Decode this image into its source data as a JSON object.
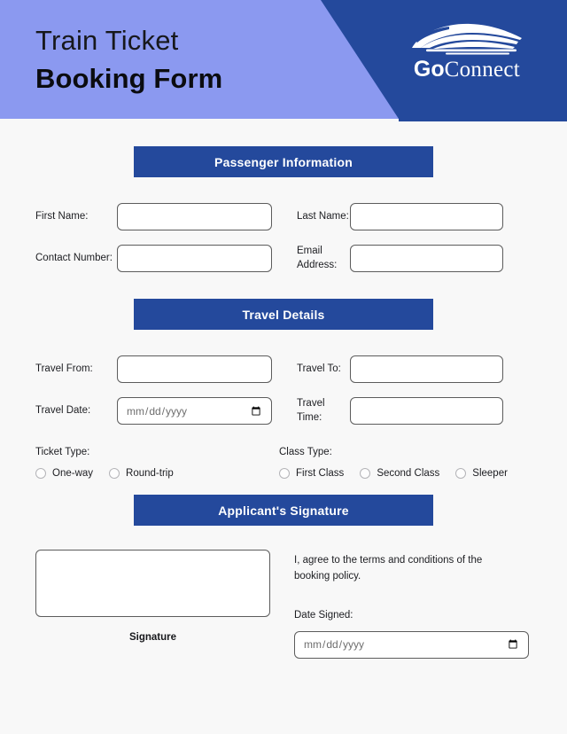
{
  "header": {
    "title_line1": "Train Ticket",
    "title_line2": "Booking Form",
    "logo": {
      "mark_name": "train-icon",
      "text_primary": "Go",
      "text_secondary": "Connect"
    },
    "colors": {
      "light_purple": "#8b99f0",
      "dark_blue": "#24499c",
      "page_background": "#f8f8f8"
    }
  },
  "sections": {
    "passenger": {
      "bar_label": "Passenger Information"
    },
    "travel": {
      "bar_label": "Travel Details"
    },
    "signature": {
      "bar_label": "Applicant's Signature"
    }
  },
  "passenger": {
    "first_name": {
      "label": "First Name:",
      "value": "",
      "placeholder": ""
    },
    "last_name": {
      "label": "Last Name:",
      "value": "",
      "placeholder": ""
    },
    "contact_number": {
      "label": "Contact Number:",
      "value": "",
      "placeholder": ""
    },
    "email_address": {
      "label": "Email Address:",
      "value": "",
      "placeholder": ""
    }
  },
  "travel": {
    "travel_from": {
      "label": "Travel From:",
      "value": "",
      "placeholder": ""
    },
    "travel_to": {
      "label": "Travel To:",
      "value": "",
      "placeholder": ""
    },
    "travel_date": {
      "label": "Travel Date:",
      "value": "",
      "placeholder": "mm/dd/yyyy"
    },
    "travel_time": {
      "label": "Travel Time:",
      "value": "",
      "placeholder": ""
    },
    "ticket_type": {
      "label": "Ticket Type:",
      "options": [
        {
          "label": "One-way",
          "selected": false
        },
        {
          "label": "Round-trip",
          "selected": false
        }
      ]
    },
    "class_type": {
      "label": "Class Type:",
      "options": [
        {
          "label": "First Class",
          "selected": false
        },
        {
          "label": "Second Class",
          "selected": false
        },
        {
          "label": "Sleeper",
          "selected": false
        }
      ]
    }
  },
  "signature": {
    "signature_caption": "Signature",
    "terms_text": "I, agree to the terms and conditions of the booking policy.",
    "date_signed": {
      "label": "Date Signed:",
      "value": "",
      "placeholder": "mm/dd/yyyy"
    }
  }
}
